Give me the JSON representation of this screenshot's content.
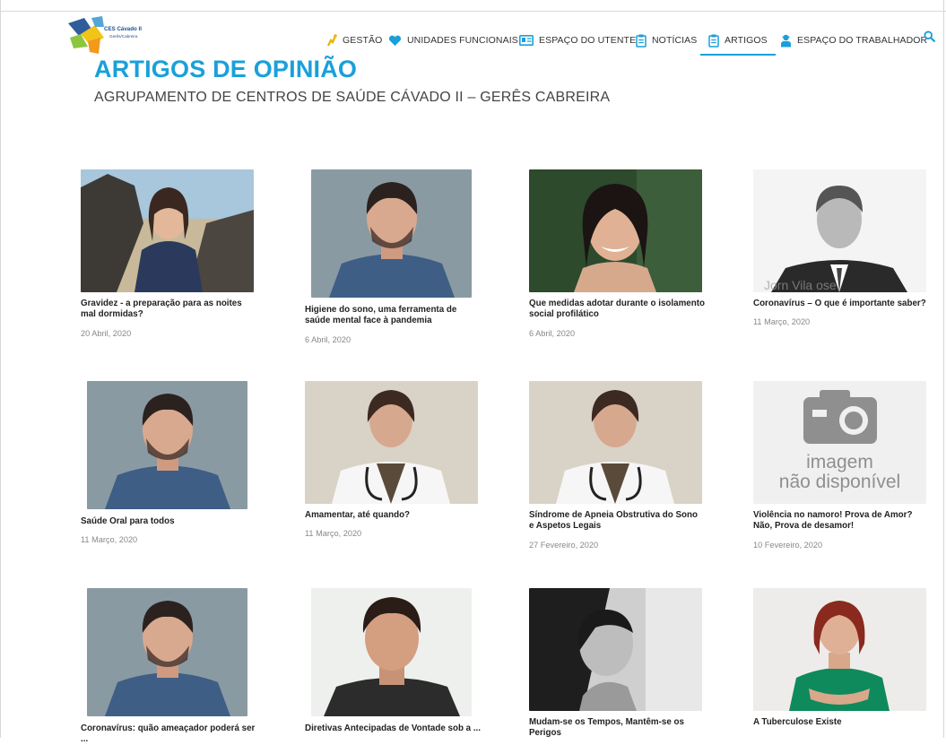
{
  "header": {
    "logo": {
      "line1": "CES Cávado II",
      "line2": "Gerês/Cabreira"
    },
    "nav": [
      {
        "label": "GESTÃO",
        "icon": "chart-icon"
      },
      {
        "label": "UNIDADES FUNCIONAIS",
        "icon": "heart-icon"
      },
      {
        "label": "ESPAÇO DO UTENTE",
        "icon": "id-card-icon"
      },
      {
        "label": "NOTÍCIAS",
        "icon": "clipboard-icon"
      },
      {
        "label": "ARTIGOS",
        "icon": "clipboard-icon",
        "active": true
      },
      {
        "label": "ESPAÇO DO TRABALHADOR",
        "icon": "worker-icon"
      }
    ],
    "accent_color": "#1a9fd9"
  },
  "page": {
    "title": "ARTIGOS DE OPINIÃO",
    "subtitle": "AGRUPAMENTO DE CENTROS DE SAÚDE CÁVADO II – GERÊS CABREIRA"
  },
  "articles": [
    {
      "title": "Gravidez - a preparação para as noites mal dormidas?",
      "date": "20 Abril, 2020"
    },
    {
      "title": "Higiene do sono, uma ferramenta de saúde mental face à pandemia",
      "date": "6 Abril, 2020"
    },
    {
      "title": "Que medidas adotar durante o isolamento social profilático",
      "date": "6 Abril, 2020"
    },
    {
      "title": "Coronavírus – O que é importante saber?",
      "date": "11 Março, 2020"
    },
    {
      "title": "Saúde Oral para todos",
      "date": "11 Março, 2020"
    },
    {
      "title": "Amamentar, até quando?",
      "date": "11 Março, 2020"
    },
    {
      "title": "Síndrome de Apneia Obstrutiva do Sono e Aspetos Legais",
      "date": "27 Fevereiro, 2020"
    },
    {
      "title": "Violência no namoro! Prova de Amor? Não, Prova de desamor!",
      "date": "10 Fevereiro, 2020",
      "placeholder": {
        "line1": "imagem",
        "line2": "não disponível"
      }
    },
    {
      "title": "Coronavírus: quão ameaçador poderá ser ...",
      "date": ""
    },
    {
      "title": "Diretivas Antecipadas de Vontade sob a ...",
      "date": ""
    },
    {
      "title": "Mudam-se os Tempos, Mantêm-se os Perigos",
      "date": ""
    },
    {
      "title": "A Tuberculose Existe",
      "date": ""
    }
  ]
}
